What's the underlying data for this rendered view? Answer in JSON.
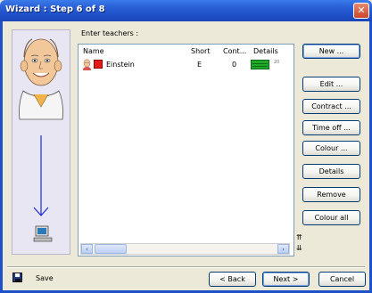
{
  "window": {
    "title": "Wizard : Step 6 of 8",
    "close_glyph": "✕"
  },
  "left_panel": {
    "portrait_icon": "teacher-face-icon",
    "arrow_icon": "down-arrow-icon",
    "computer_icon": "computer-icon"
  },
  "main": {
    "prompt": "Enter teachers :",
    "columns": [
      "Name",
      "Short",
      "Cont...",
      "Details"
    ],
    "rows": [
      {
        "name": "Einstein",
        "short": "E",
        "contract": "0",
        "colour": "#e21b1b",
        "details_color": "#1faa2b",
        "details_note": "20"
      }
    ]
  },
  "side_buttons": [
    "New ...",
    "Edit ...",
    "Contract ...",
    "Time off ...",
    "Colour ...",
    "Details",
    "Remove",
    "Colour all"
  ],
  "footer": {
    "save": "Save",
    "back": "< Back",
    "next": "Next >",
    "cancel": "Cancel"
  },
  "colors": {
    "title_bar": "#1e50c8",
    "accent": "#003c74"
  }
}
